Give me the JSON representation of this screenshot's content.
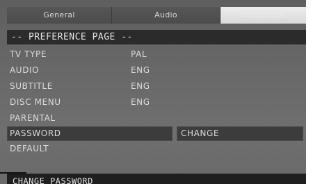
{
  "tabs": [
    {
      "label": "General"
    },
    {
      "label": "Audio"
    },
    {
      "label": "Preference"
    }
  ],
  "page_title": "-- PREFERENCE PAGE --",
  "settings": [
    {
      "label": "TV TYPE",
      "value": "PAL"
    },
    {
      "label": "AUDIO",
      "value": "ENG"
    },
    {
      "label": "SUBTITLE",
      "value": "ENG"
    },
    {
      "label": "DISC MENU",
      "value": "ENG"
    },
    {
      "label": "PARENTAL",
      "value": ""
    },
    {
      "label": "PASSWORD",
      "value": "CHANGE"
    },
    {
      "label": "DEFAULT",
      "value": ""
    }
  ],
  "status_text": "CHANGE PASSWORD",
  "colors": {
    "screen_bg": "#666666",
    "header_bg": "#2b2b2b",
    "selected_bg": "#3c3c3c",
    "text": "#dcdcdc"
  }
}
